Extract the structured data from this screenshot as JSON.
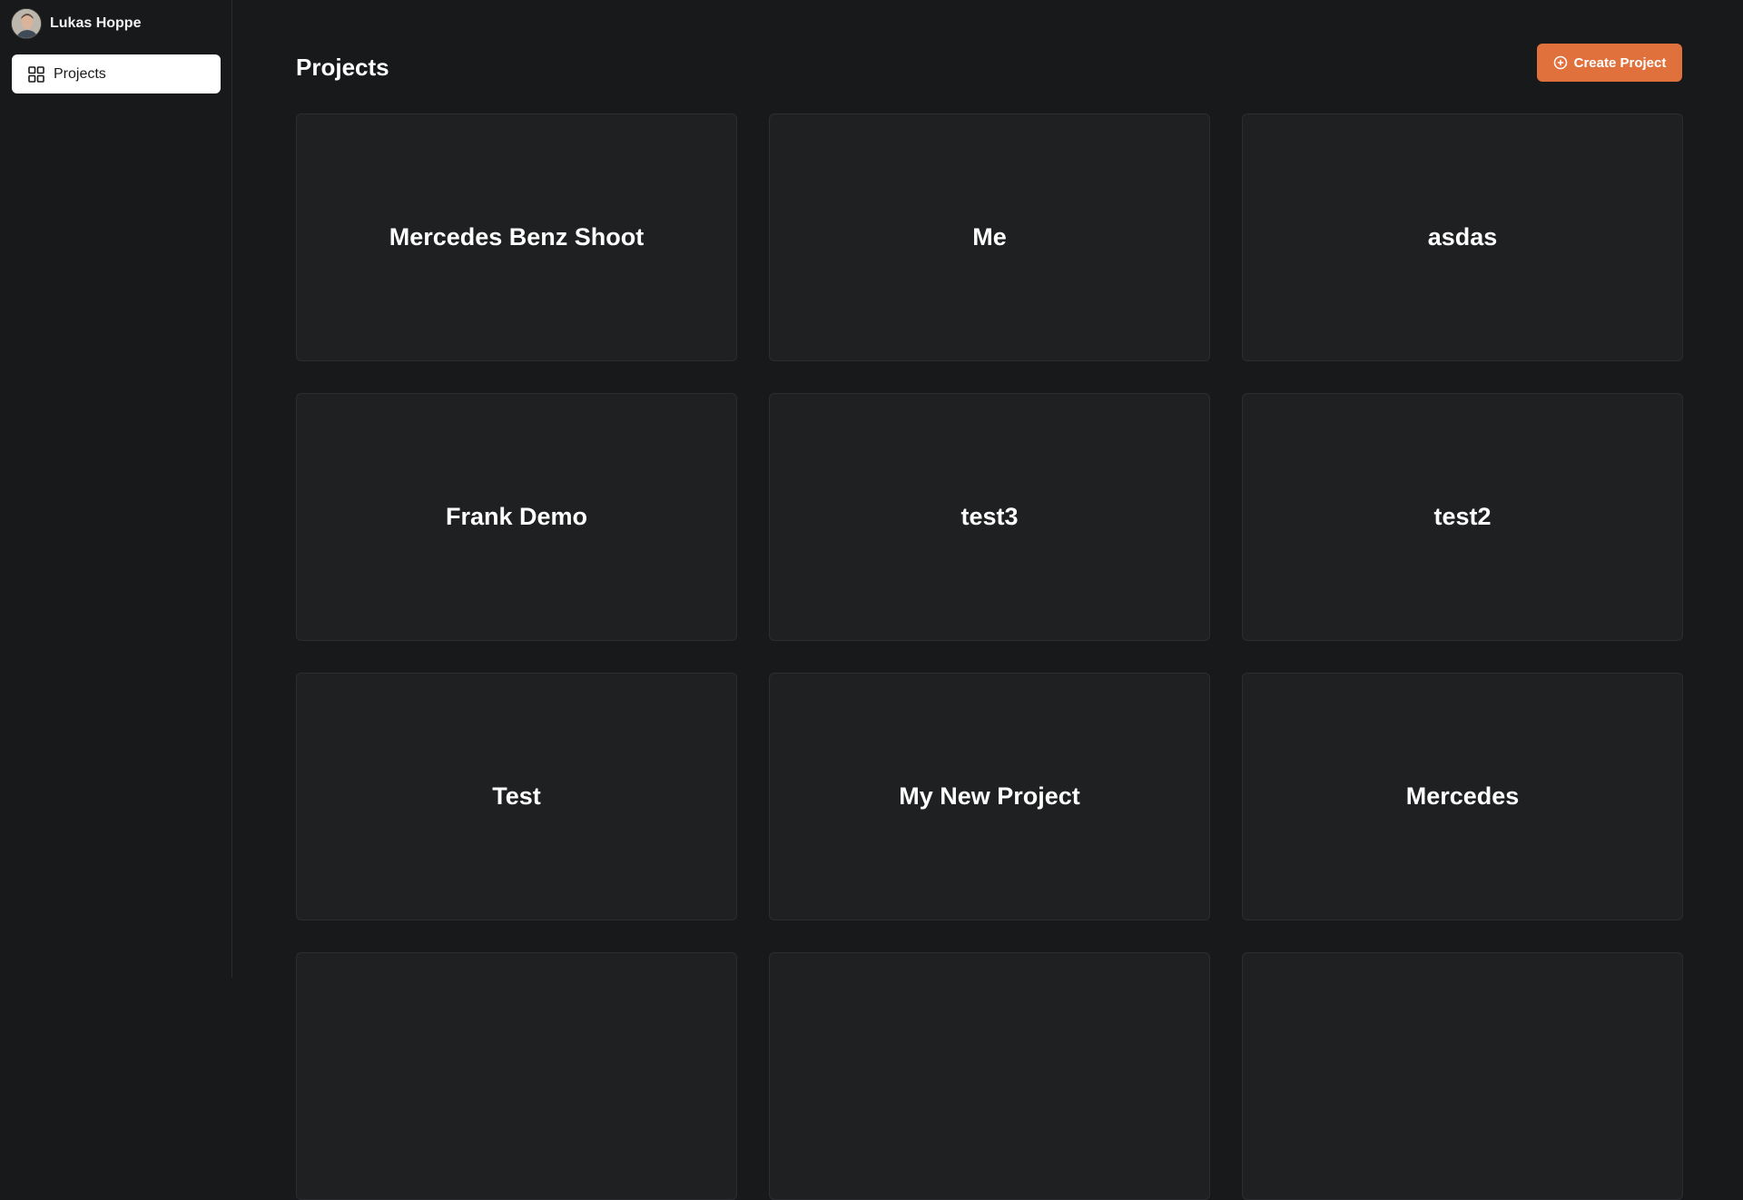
{
  "user": {
    "name": "Lukas Hoppe",
    "avatar_icon": "avatar-photo"
  },
  "sidebar": {
    "items": [
      {
        "label": "Projects",
        "icon": "grid-icon"
      }
    ]
  },
  "main": {
    "title": "Projects",
    "create_button": {
      "label": "Create Project",
      "icon": "plus-circle-icon",
      "color": "#e0713d"
    },
    "projects": [
      {
        "name": "Mercedes Benz Shoot"
      },
      {
        "name": "Me"
      },
      {
        "name": "asdas"
      },
      {
        "name": "Frank Demo"
      },
      {
        "name": "test3"
      },
      {
        "name": "test2"
      },
      {
        "name": "Test"
      },
      {
        "name": "My New Project"
      },
      {
        "name": "Mercedes"
      },
      {
        "name": ""
      },
      {
        "name": ""
      },
      {
        "name": ""
      }
    ]
  },
  "colors": {
    "background": "#18191b",
    "card": "#1f2022",
    "accent": "#e0713d",
    "nav_active": "#ffffff"
  }
}
